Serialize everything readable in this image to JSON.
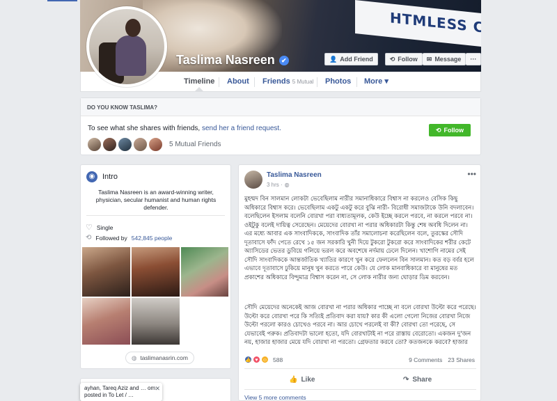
{
  "profile": {
    "name": "Taslima Nasreen",
    "verified_icon": "✔"
  },
  "cover": {
    "sign_text": "HTMLESS C"
  },
  "header_buttons": {
    "add_friend": "Add Friend",
    "follow": "Follow",
    "message": "Message",
    "more": "···"
  },
  "nav": {
    "timeline": "Timeline",
    "about": "About",
    "friends": "Friends",
    "friends_mutual": "5 Mutual",
    "photos": "Photos",
    "more": "More ▾"
  },
  "do_you_know": {
    "heading": "DO YOU KNOW TASLIMA?",
    "text_prefix": "To see what she shares with friends,",
    "link": "send her a friend request.",
    "follow": "Follow",
    "mutual_friends": "5 Mutual Friends"
  },
  "intro": {
    "title": "Intro",
    "bio": "Taslima Nasreen is an award-winning writer, physician, secular humanist and human rights defender.",
    "relationship": "Single",
    "followed_prefix": "Followed by",
    "followed_count": "542,845 people",
    "website": "taslimanasrin.com"
  },
  "notification": {
    "text": "ayhan, Tareq Aziz and … om posted in To Let / …",
    "close": "✕"
  },
  "post": {
    "author": "Taslima Nasreen",
    "time": "3 hrs · ",
    "privacy_icon": "◍",
    "more": "•••",
    "paragraph1": "মুহম্মদ বিন সালমান লোকটা ভেবেছিলাম নারীর সমানাধিকারে বিশ্বাস না করলেও বেসিক কিছু অধিকারে বিশ্বাস করে। ভেবেছিলাম একটু একটু করে বুঝি নারী- বিরোধী সমাজটাকে উনি বদলাবেন। বলেছিলেন ইসলাম বলেনি বোরখা পরা বাধ্যতামূলক, কেউ ইচ্ছে করলে পরবে, না করলে পরবে না। ওইটুকু বলেই দায়িত্ব সেরেছেন। মেয়েদের বোরখা না পরার অধিকারটা কিন্তু শেষ অবধি দিলেন না। এর মধ্যে আবার এক সাংবাদিককে, সাংবাদিক তাঁর সমালোচনা করেছিলেন বলে, তুরস্কের সৌদি দূতাবাসে ফাঁদ পেতে রেখে ১৫ জন সরকারি খুনী দিয়ে টুকরো টুকরো করে সাংবাদিকের শরীর কেটে অ্যাসিডের ভেতর ডুবিয়ে গলিয়ে ভরল করে অবশেষে নর্দমায় ঢেলে দিলেন। খাশোগি নামের সেই সৌদি সাংবাদিককে আন্তর্জাতিক খ্যাতির কারণে খুন করে ফেললেন বিন সালমান। কত বড় বর্বর হলে এভাবে দূতাবাসে ঢুকিয়ে মানুষ খুন করতে পারে কেউ। যে লোক মানবাধিকারে বা মানুষের মত প্রকাশের অধিকারে বিন্দুমাত্র বিশ্বাস করেন না, সে লোক নারীর জন্য ঘোড়ার ডিম করবেন।",
    "paragraph2": "সৌদি মেয়েদের অনেকেই আজ বোরখা না পরার অধিকার পাচ্ছে না বলে বোরখা উল্টো করে পরেছে। উল্টো করে বোরখা পরে কি সত্যিই প্রতিবাদ করা যায়? কার কী এলো গেলো নিজের বোরখা নিজে উল্টো পরলো কারও চোখেও পরবে না। আর চোখে পরলেই বা কী? বোরখা তো পরেছে, সে যেভাবেই পরুক। প্রতিবাদটা ভালো হতো, যদি বোরখাটাই না পরে রাস্তায় বেরোতো। একজন দু'জন নয়, হাজার হাজার মেয়ে যদি বোরখা না পরতো। গ্রেফতার করবে তো? কতজনকে করবে? হাজার হাজার? করুক না।",
    "reaction_count": "588",
    "comments": "9 Comments",
    "shares": "23 Shares",
    "like": "Like",
    "share": "Share",
    "view_more": "View 5 more comments"
  },
  "colors": {
    "facebook_blue": "#4267b2",
    "link_blue": "#385898",
    "follow_green": "#42b72a",
    "page_bg": "#e9ebee"
  }
}
